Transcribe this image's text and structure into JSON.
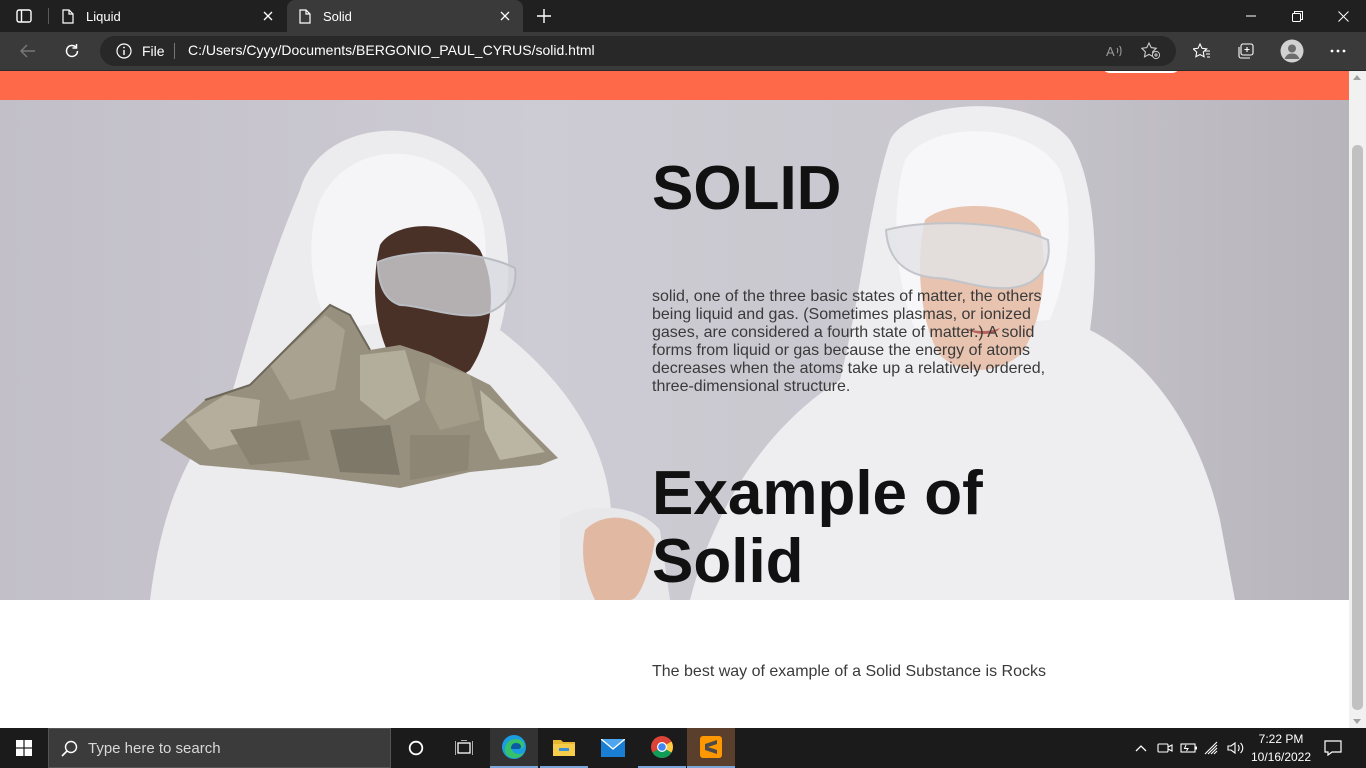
{
  "browser": {
    "tabs": [
      {
        "title": "Liquid"
      },
      {
        "title": "Solid"
      }
    ],
    "address": {
      "scheme_label": "File",
      "url": "C:/Users/Cyyy/Documents/BERGONIO_PAUL_CYRUS/solid.html"
    }
  },
  "page": {
    "hero": {
      "title": "SOLID",
      "description": "solid, one of the three basic states of matter, the others being liquid and gas. (Sometimes plasmas, or ionized gases, are considered a fourth state of matter.) A solid forms from liquid or gas because the energy of atoms decreases when the atoms take up a relatively ordered, three-dimensional structure.",
      "example_title": "Example of Solid"
    },
    "example_text": "The best way of example of a Solid Substance is Rocks",
    "colors": {
      "nav_bar": "#fe6a49",
      "heading": "#111111"
    }
  },
  "taskbar": {
    "search_placeholder": "Type here to search",
    "apps": [
      "cortana",
      "task-view",
      "edge",
      "file-explorer",
      "mail",
      "chrome",
      "sublime-text"
    ],
    "clock": {
      "time": "7:22 PM",
      "date": "10/16/2022"
    }
  }
}
